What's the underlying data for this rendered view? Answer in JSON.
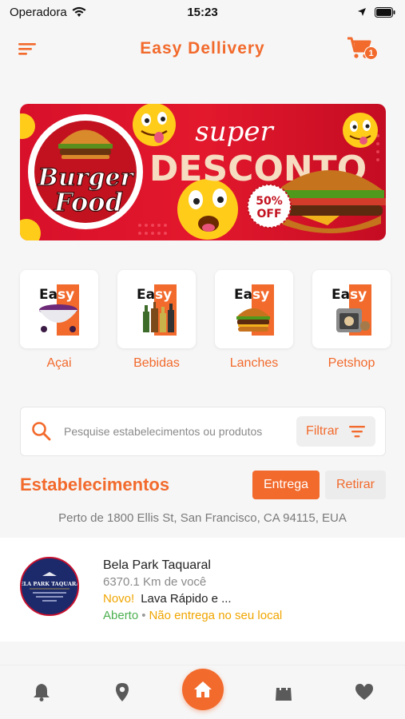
{
  "status_bar": {
    "carrier": "Operadora",
    "time": "15:23"
  },
  "header": {
    "title": "Easy Dellivery",
    "cart_count": "1"
  },
  "banner": {
    "brand_top": "Burger",
    "brand_bottom": "Food",
    "headline_top": "super",
    "headline_main": "DESCONTO",
    "discount_value": "50%",
    "discount_label": "OFF"
  },
  "categories": [
    {
      "label": "Açai",
      "logo_a": "Ea",
      "logo_b": "sy"
    },
    {
      "label": "Bebidas",
      "logo_a": "Ea",
      "logo_b": "sy"
    },
    {
      "label": "Lanches",
      "logo_a": "Ea",
      "logo_b": "sy"
    },
    {
      "label": "Petshop",
      "logo_a": "Ea",
      "logo_b": "sy"
    }
  ],
  "search": {
    "placeholder": "Pesquise estabelecimentos ou produtos",
    "filter_label": "Filtrar"
  },
  "section": {
    "title": "Estabelecimentos",
    "delivery_label": "Entrega",
    "pickup_label": "Retirar",
    "location": "Perto de 1800 Ellis St, San Francisco, CA 94115, EUA"
  },
  "stores": [
    {
      "name": "Bela Park Taquaral",
      "distance": "6370.1 Km de você",
      "promo_badge": "Novo!",
      "promo_text": "Lava Rápido e ...",
      "status": "Aberto",
      "delivery_note": "Não entrega no seu local",
      "logo_text": "BELA PARK TAQUARAL"
    }
  ],
  "colors": {
    "accent": "#f26a2c",
    "open": "#4caf50",
    "warning": "#f0a500"
  },
  "icons": {
    "menu": "menu-icon",
    "cart": "cart-icon",
    "search": "search-icon",
    "filter": "filter-icon",
    "nav": [
      "bell-icon",
      "location-pin-icon",
      "home-icon",
      "shopping-bag-icon",
      "heart-icon"
    ]
  }
}
